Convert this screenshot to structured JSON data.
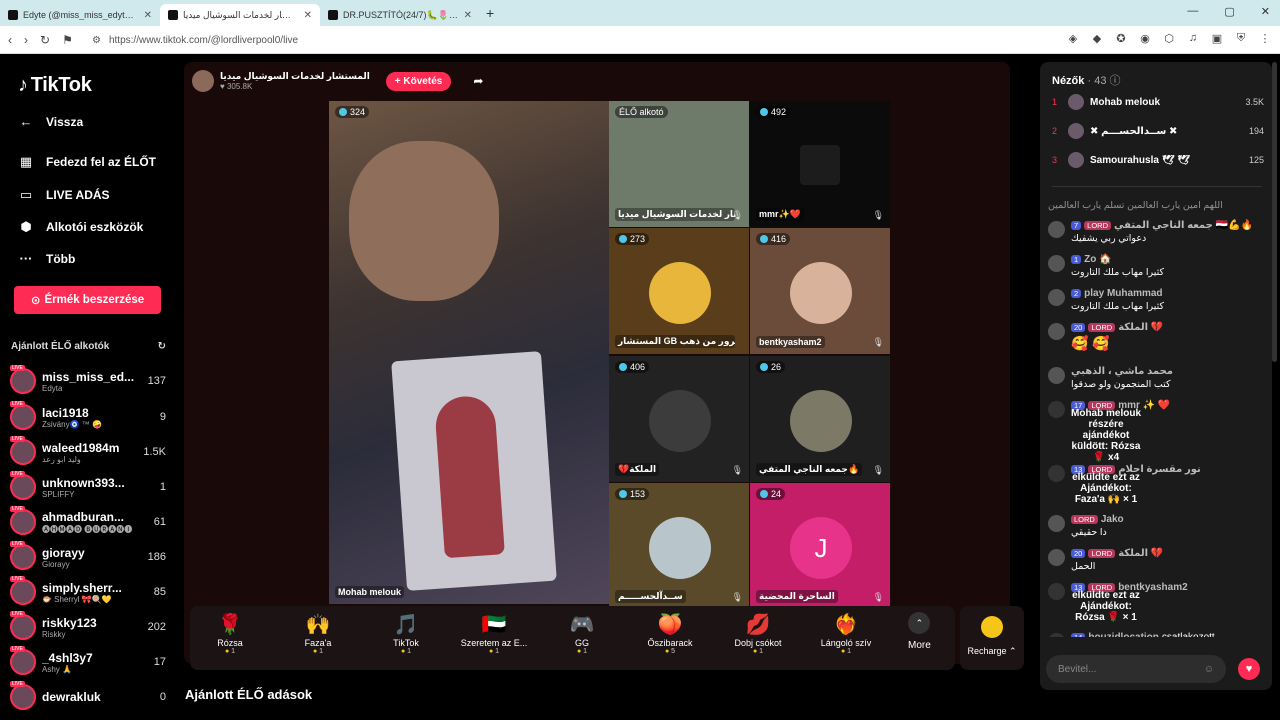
{
  "browser": {
    "tabs": [
      {
        "title": "Edyte (@miss_miss_edyte) ÉLŐ adása"
      },
      {
        "title": "المستشار لخدمات السوشيال ميديا"
      },
      {
        "title": "DR.PUSZTÍTÓ(24/7)🐛🌷🖤🍀"
      }
    ],
    "url": "https://www.tiktok.com/@lordliverpool0/live"
  },
  "sidebar": {
    "logo": "TikTok",
    "nav": [
      {
        "label": "Vissza",
        "icon": "back-arrow-icon"
      },
      {
        "label": "Fedezd fel az ÉLŐT",
        "icon": "explore-live-icon"
      },
      {
        "label": "LIVE ADÁS",
        "icon": "camera-icon"
      },
      {
        "label": "Alkotói eszközök",
        "icon": "creator-tools-icon"
      },
      {
        "label": "Több",
        "icon": "more-dots-icon"
      }
    ],
    "coins_button": "Érmék beszerzése",
    "suggested_heading": "Ajánlott ÉLŐ alkotók",
    "creators": [
      {
        "user": "miss_miss_ed...",
        "sub": "Edyta",
        "viewers": "137"
      },
      {
        "user": "laci1918",
        "sub": "Zsivány🧿 ™ 🤪",
        "viewers": "9"
      },
      {
        "user": "waleed1984m",
        "sub": "وليد ابو رعد",
        "viewers": "1.5K"
      },
      {
        "user": "unknown393...",
        "sub": "SPLIFFY",
        "viewers": "1"
      },
      {
        "user": "ahmadburan...",
        "sub": "🅐🅗🅜🅐🅓 🅑🅤🅡🅐🅝🅘",
        "viewers": "61"
      },
      {
        "user": "giorayy",
        "sub": "Giorayy",
        "viewers": "186"
      },
      {
        "user": "simply.sherr...",
        "sub": "🐡 Sherryl 🎀🍭💛",
        "viewers": "85"
      },
      {
        "user": "riskky123",
        "sub": "Riskky",
        "viewers": "202"
      },
      {
        "user": "_4shl3y7",
        "sub": "Ashy 🙏",
        "viewers": "17"
      },
      {
        "user": "dewrakluk",
        "sub": "",
        "viewers": "0"
      }
    ]
  },
  "stream": {
    "host_name": "المستشار لخدمات السوشيال ميديا",
    "host_likes": "305.8K",
    "follow_label": "+ Követés",
    "main_tile": {
      "count": "324",
      "name": "Mohab melouk"
    },
    "tiles": [
      {
        "count": "ÉLŐ alkotó",
        "name": "المستشار لخدمات السوشيال ميديا",
        "bg": "#6f7b6a",
        "circle": ""
      },
      {
        "count": "492",
        "name": "mmr✨❤️",
        "bg": "#0b0b0b",
        "circle": ""
      },
      {
        "count": "273",
        "name": "المستشار GB ســرور من ذهب",
        "bg": "#5a3e1c",
        "circle": "#e8b63b"
      },
      {
        "count": "416",
        "name": "bentkyasham2",
        "bg": "#6b4b3a",
        "circle": "#d8b29a"
      },
      {
        "count": "406",
        "name": "💔الملكة",
        "bg": "#222222",
        "circle": "#3c3c3c"
      },
      {
        "count": "26",
        "name": "جمعه الناجي المتفي🔥",
        "bg": "#1f1f1f",
        "circle": "#7c7a66"
      },
      {
        "count": "153",
        "name": "ســدآلحســـــم",
        "bg": "#5b4a2a",
        "circle": "#b8c6cc"
      },
      {
        "count": "24",
        "name": "الساحرة المحضية",
        "bg": "#c41e69",
        "circle": "#e8338b",
        "letter": "J"
      }
    ]
  },
  "gifts": [
    {
      "name": "Rózsa",
      "price": "1",
      "icon": "🌹"
    },
    {
      "name": "Faza'a",
      "price": "1",
      "icon": "🙌"
    },
    {
      "name": "TikTok",
      "price": "1",
      "icon": "🎵"
    },
    {
      "name": "Szeretem az E...",
      "price": "1",
      "icon": "🇦🇪"
    },
    {
      "name": "GG",
      "price": "1",
      "icon": "🎮"
    },
    {
      "name": "Őszibarack",
      "price": "5",
      "icon": "🍑"
    },
    {
      "name": "Dobj csókot",
      "price": "1",
      "icon": "💋"
    },
    {
      "name": "Lángoló szív",
      "price": "1",
      "icon": "❤️‍🔥"
    }
  ],
  "more_label": "More",
  "recharge_label": "Recharge ⌃",
  "recommended_heading": "Ajánlott ÉLŐ adások",
  "viewers": {
    "heading": "Nézők",
    "count": "43",
    "top": [
      {
        "rank": "1",
        "name": "Mohab melouk",
        "score": "3.5K"
      },
      {
        "rank": "2",
        "name": "✖ ســدآلحســـم ✖",
        "score": "194"
      },
      {
        "rank": "3",
        "name": "Samourahusla 🕊 🕊",
        "score": "125"
      }
    ]
  },
  "chat": [
    {
      "badges": [],
      "name": "",
      "text": "اللهم امين يارب العالمين تسلم يارب العالمين",
      "gift": false,
      "faded": true
    },
    {
      "badges": [
        "7",
        "LORD"
      ],
      "name": "جمعه الناجي المتفي 🇾🇪💪🔥",
      "text": "دعواتي ربي يشفيك",
      "gift": false
    },
    {
      "badges": [
        "1"
      ],
      "name": "Zo 🏠",
      "text": "كثيرا مهاب ملك التاروت",
      "gift": false
    },
    {
      "badges": [
        "2"
      ],
      "name": "play Muhammad",
      "text": "كثيرا مهاب ملك التاروت",
      "gift": false
    },
    {
      "badges": [
        "20",
        "LORD"
      ],
      "name": "الملكة 💔",
      "text": "🥰 🥰",
      "gift": false
    },
    {
      "badges": [],
      "name": "محمد ماشي ، الذهبي",
      "text": "كتب المنجمون ولو صدقوا",
      "gift": false
    },
    {
      "badges": [
        "17",
        "LORD"
      ],
      "name": "mmr ✨ ❤️",
      "text": "Mohab melouk részére ajándékot küldött: Rózsa 🌹 x4",
      "gift": true
    },
    {
      "badges": [
        "13",
        "LORD"
      ],
      "name": "نور مقسرة احلام",
      "text": "elküldte ezt az Ajándékot: Faza'a 🙌 × 1",
      "gift": true
    },
    {
      "badges": [
        "LORD"
      ],
      "name": "Jako",
      "text": "دا حقيقي",
      "gift": false
    },
    {
      "badges": [
        "20",
        "LORD"
      ],
      "name": "الملكة 💔",
      "text": "الحمل",
      "gift": false
    },
    {
      "badges": [
        "13",
        "LORD"
      ],
      "name": "bentkyasham2",
      "text": "elküldte ezt az Ajándékot: Rózsa 🌹 × 1",
      "gift": true
    },
    {
      "badges": [
        "14"
      ],
      "name": "bouzidlocation",
      "text": "csatlakozott",
      "gift": false,
      "joined": true
    }
  ],
  "input_placeholder": "Bevitel..."
}
